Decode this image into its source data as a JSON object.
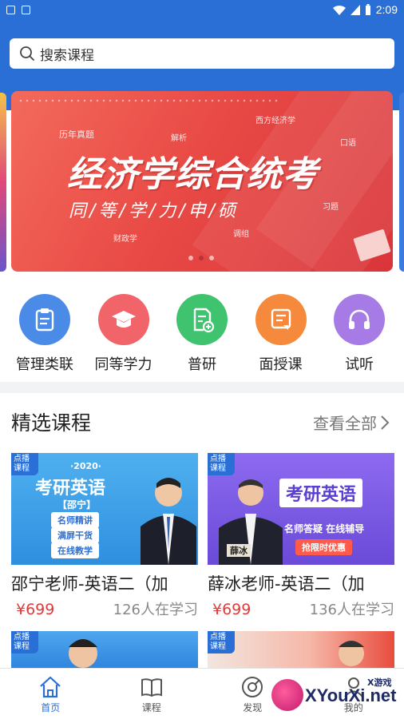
{
  "status_bar": {
    "time": "2:09",
    "left_icons": [
      "image-icon",
      "notification-icon"
    ],
    "right_icons": [
      "wifi-icon",
      "signal-icon",
      "battery-icon"
    ]
  },
  "search": {
    "placeholder": "搜索课程"
  },
  "banner": {
    "title": "经济学综合统考",
    "subtitle": "同/等/学/力/申/硕",
    "small_labels": [
      "历年真题",
      "西方经济学",
      "口语",
      "财政学",
      "调组",
      "习题",
      "解析"
    ],
    "active_page": 2,
    "page_count": 3
  },
  "categories": [
    {
      "label": "管理类联",
      "icon": "clipboard-icon",
      "color": "#4a8be8"
    },
    {
      "label": "同等学力",
      "icon": "graduation-cap-icon",
      "color": "#f0646a"
    },
    {
      "label": "普研",
      "icon": "document-add-icon",
      "color": "#3fc36f"
    },
    {
      "label": "面授课",
      "icon": "chat-doc-icon",
      "color": "#f58a3c"
    },
    {
      "label": "试听",
      "icon": "headphones-icon",
      "color": "#a77be6"
    }
  ],
  "section": {
    "title": "精选课程",
    "more_label": "查看全部"
  },
  "courses": [
    {
      "tag": "点播课程",
      "title": "邵宁老师-英语二（加",
      "price": "¥699",
      "learners": "126人在学习",
      "thumb": {
        "year": "·2020·",
        "heading": "考研英语",
        "teacher": "【邵宁】",
        "pills": [
          "名师精讲",
          "满屏干货",
          "在线教学"
        ]
      }
    },
    {
      "tag": "点播课程",
      "title": "薛冰老师-英语二（加",
      "price": "¥699",
      "learners": "136人在学习",
      "thumb": {
        "heading": "考研英语",
        "line": "名师答疑  在线辅导",
        "pill": "抢限时优惠",
        "name": "薛冰"
      }
    },
    {
      "tag": "点播课程"
    },
    {
      "tag": "点播课程"
    }
  ],
  "tabbar": {
    "tabs": [
      {
        "label": "首页",
        "icon": "home-icon",
        "active": true
      },
      {
        "label": "课程",
        "icon": "book-icon",
        "active": false
      },
      {
        "label": "发现",
        "icon": "compass-icon",
        "active": false
      },
      {
        "label": "我的",
        "icon": "user-icon",
        "active": false
      }
    ]
  },
  "watermark": {
    "main": "XYouXi.net",
    "sub": "X游戏"
  },
  "colors": {
    "primary": "#2a6fd6",
    "price": "#e03a3a"
  }
}
